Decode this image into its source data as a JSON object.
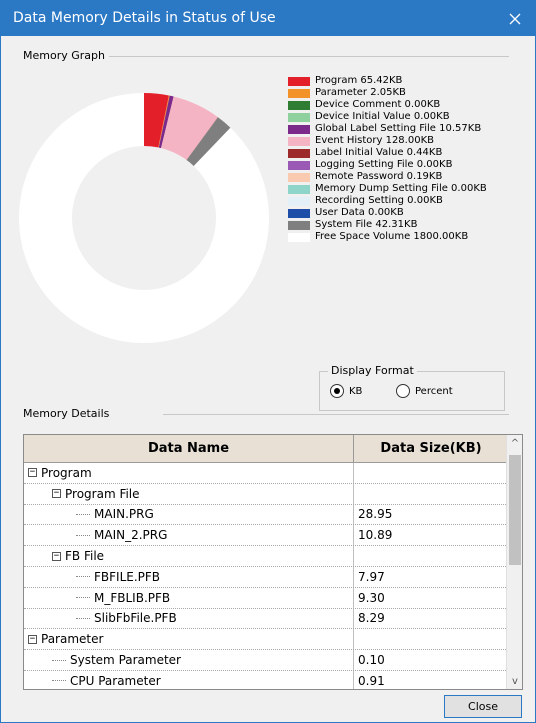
{
  "window": {
    "title": "Data Memory Details in Status of Use"
  },
  "graph": {
    "group_label": "Memory Graph",
    "legend": [
      {
        "label": "Program  65.42KB",
        "color": "#e3202a",
        "value_kb": 65.42
      },
      {
        "label": "Parameter  2.05KB",
        "color": "#f4922a",
        "value_kb": 2.05
      },
      {
        "label": "Device Comment  0.00KB",
        "color": "#2e7d32",
        "value_kb": 0.0
      },
      {
        "label": "Device Initial Value  0.00KB",
        "color": "#8fd19e",
        "value_kb": 0.0
      },
      {
        "label": "Global Label Setting File  10.57KB",
        "color": "#7b2a8b",
        "value_kb": 10.57
      },
      {
        "label": "Event History  128.00KB",
        "color": "#f4b4c4",
        "value_kb": 128.0
      },
      {
        "label": "Label Initial Value  0.44KB",
        "color": "#9c2a2a",
        "value_kb": 0.44
      },
      {
        "label": "Logging Setting File  0.00KB",
        "color": "#9b59b6",
        "value_kb": 0.0
      },
      {
        "label": "Remote Password  0.19KB",
        "color": "#f9c9b0",
        "value_kb": 0.19
      },
      {
        "label": "Memory Dump Setting File  0.00KB",
        "color": "#8fd4c8",
        "value_kb": 0.0
      },
      {
        "label": "Recording Setting  0.00KB",
        "color": "#e4f0f7",
        "value_kb": 0.0
      },
      {
        "label": "User Data  0.00KB",
        "color": "#1f4ea8",
        "value_kb": 0.0
      },
      {
        "label": "System File  42.31KB",
        "color": "#7f7f7f",
        "value_kb": 42.31
      },
      {
        "label": "Free Space Volume  1800.00KB",
        "color": "#ffffff",
        "value_kb": 1800.0
      }
    ]
  },
  "display_format": {
    "label": "Display Format",
    "options": [
      {
        "label": "KB",
        "selected": true
      },
      {
        "label": "Percent",
        "selected": false
      }
    ]
  },
  "details": {
    "group_label": "Memory Details",
    "columns": [
      "Data Name",
      "Data Size(KB)"
    ],
    "rows": [
      {
        "name": "Program",
        "size": "",
        "level": 0,
        "expander": "−"
      },
      {
        "name": "Program File",
        "size": "",
        "level": 1,
        "expander": "−"
      },
      {
        "name": "MAIN.PRG",
        "size": "28.95",
        "level": 2,
        "expander": ""
      },
      {
        "name": "MAIN_2.PRG",
        "size": "10.89",
        "level": 2,
        "expander": ""
      },
      {
        "name": "FB File",
        "size": "",
        "level": 1,
        "expander": "−"
      },
      {
        "name": "FBFILE.PFB",
        "size": "7.97",
        "level": 2,
        "expander": ""
      },
      {
        "name": "M_FBLIB.PFB",
        "size": "9.30",
        "level": 2,
        "expander": ""
      },
      {
        "name": "SlibFbFile.PFB",
        "size": "8.29",
        "level": 2,
        "expander": ""
      },
      {
        "name": "Parameter",
        "size": "",
        "level": 0,
        "expander": "−"
      },
      {
        "name": "System Parameter",
        "size": "0.10",
        "level": 1,
        "expander": ""
      },
      {
        "name": "CPU Parameter",
        "size": "0.91",
        "level": 1,
        "expander": ""
      }
    ]
  },
  "buttons": {
    "close": "Close"
  },
  "icons": {
    "window_close": "close-icon",
    "scroll_up": "scroll-up-arrow-icon",
    "scroll_down": "scroll-down-arrow-icon"
  }
}
